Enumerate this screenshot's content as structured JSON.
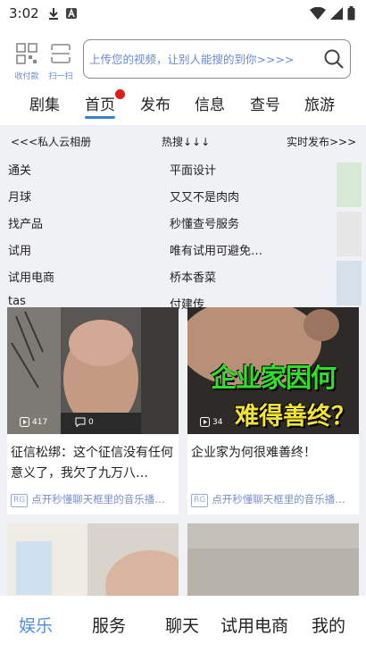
{
  "status_bar": {
    "time": "3:02"
  },
  "header": {
    "collect_label": "收付款",
    "scan_label": "扫一扫",
    "search_placeholder": "上传您的视频，让别人能搜的到你>>>>"
  },
  "tabs": [
    "剧集",
    "首页",
    "发布",
    "信息",
    "查号",
    "旅游"
  ],
  "active_tab": "首页",
  "topnav": {
    "left": "<<<私人云相册",
    "center": "热搜↓↓↓",
    "right": "实时发布>>>"
  },
  "hot_list": [
    [
      "通关",
      "平面设计"
    ],
    [
      "月球",
      "又又不是肉肉"
    ],
    [
      "找产品",
      "秒懂查号服务"
    ],
    [
      "试用",
      "唯有试用可避免…"
    ],
    [
      "试用电商",
      "桥本香菜"
    ],
    [
      "tas",
      "付建传"
    ]
  ],
  "swatches": [
    "#d7e8d6",
    "#e6e6e6",
    "#d6e0ea"
  ],
  "cards": [
    {
      "likes": "417",
      "comments": "0",
      "title": "征信松绑：这个征信没有任何意义了，我欠了九万八…",
      "sub_badge": "RG",
      "sub": "点开秒懂聊天框里的音乐播…"
    },
    {
      "likes": "34",
      "comments": "",
      "overlay1": "企业家因何",
      "overlay2": "难得善终？",
      "title": "企业家为何很难善终！",
      "sub_badge": "RG",
      "sub": "点开秒懂聊天框里的音乐播…"
    }
  ],
  "bottom_nav": [
    "娱乐",
    "服务",
    "聊天",
    "试用电商",
    "我的"
  ],
  "active_bottom": "娱乐",
  "colors": {
    "accent": "#3f7ed8",
    "link": "#6a8bd0",
    "badge": "#e21b1b"
  }
}
